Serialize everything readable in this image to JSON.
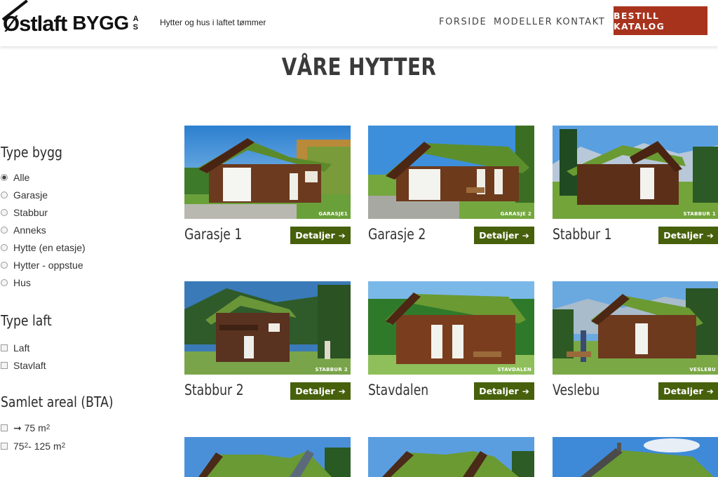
{
  "header": {
    "logo_main": "Østlaft",
    "logo_bygg": "BYGG",
    "logo_as": [
      "A",
      "S"
    ],
    "tagline": "Hytter og hus i laftet tømmer",
    "nav": [
      "FORSIDE",
      "MODELLER",
      "KONTAKT"
    ],
    "cta": "BESTILL KATALOG"
  },
  "page_title": "VÅRE HYTTER",
  "filters": {
    "type_bygg": {
      "heading": "Type bygg",
      "options": [
        "Alle",
        "Garasje",
        "Stabbur",
        "Anneks",
        "Hytte (en etasje)",
        "Hytter - oppstue",
        "Hus"
      ],
      "selected": "Alle"
    },
    "type_laft": {
      "heading": "Type laft",
      "options": [
        "Laft",
        "Stavlaft"
      ]
    },
    "areal": {
      "heading": "Samlet areal (BTA)",
      "options": [
        {
          "prefix": "➞ 75 m",
          "sup": "2",
          "mid": "",
          "sup2": ""
        },
        {
          "prefix": "75",
          "sup": "2",
          "mid": " - 125 m",
          "sup2": "2"
        }
      ]
    }
  },
  "cards": [
    {
      "name": "Garasje 1",
      "button": "Detaljer",
      "watermark": "GARASJE1"
    },
    {
      "name": "Garasje 2",
      "button": "Detaljer",
      "watermark": "GARASJE 2"
    },
    {
      "name": "Stabbur 1",
      "button": "Detaljer",
      "watermark": "STABBUR 1"
    },
    {
      "name": "Stabbur 2",
      "button": "Detaljer",
      "watermark": "STABBUR 2"
    },
    {
      "name": "Stavdalen",
      "button": "Detaljer",
      "watermark": "STAVDALEN"
    },
    {
      "name": "Veslebu",
      "button": "Detaljer",
      "watermark": "VESLEBU"
    }
  ],
  "colors": {
    "cta_bg": "#a8331d",
    "button_bg": "#47600c",
    "text": "#333333"
  },
  "icons": {
    "button_arrow": "arrow-right-icon",
    "logo": "ostlaft-logo"
  }
}
